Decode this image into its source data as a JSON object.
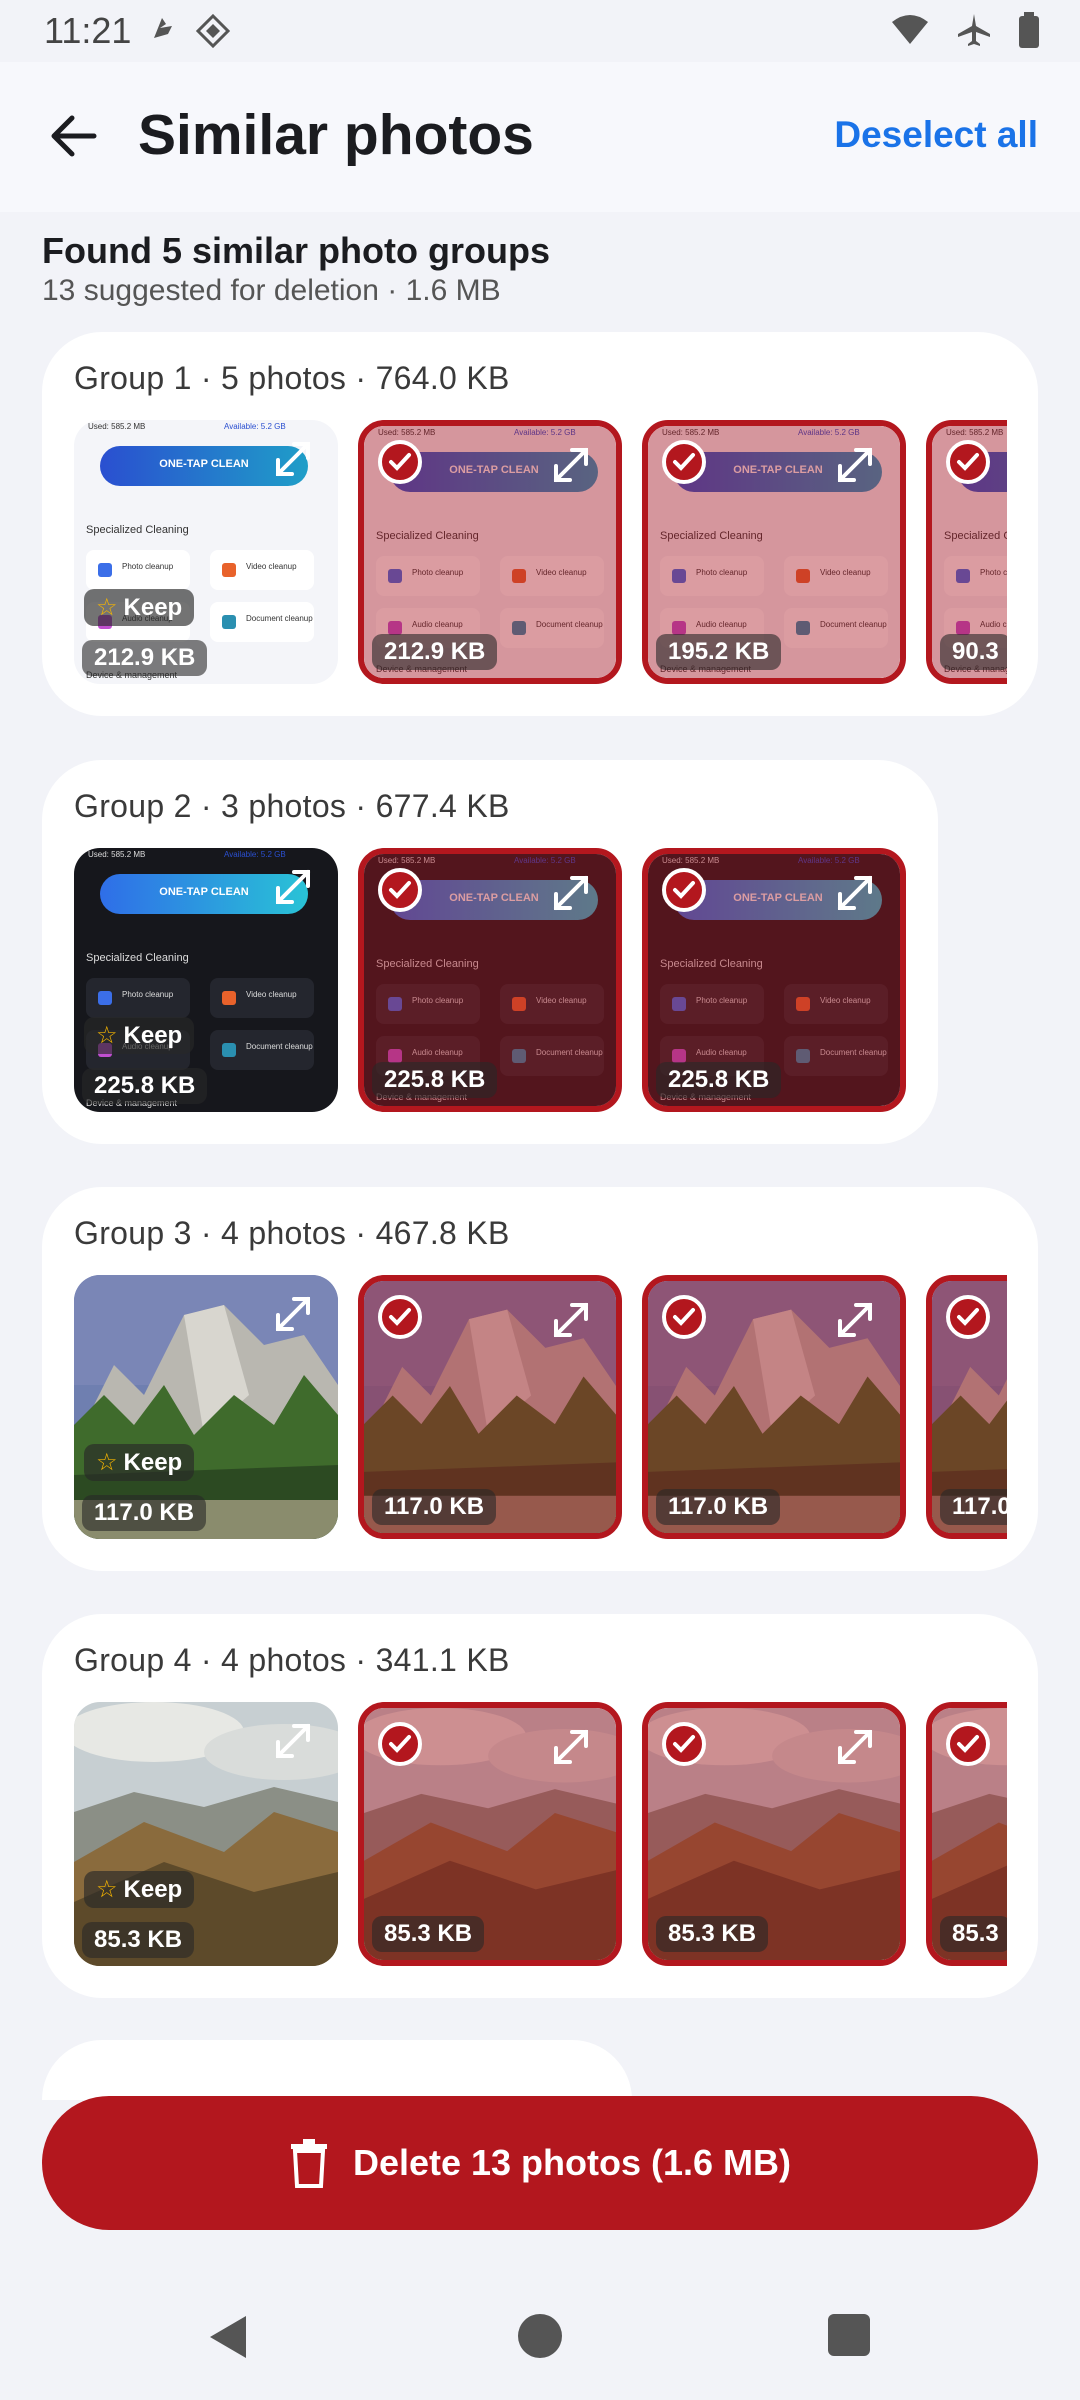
{
  "status": {
    "time": "11:21"
  },
  "header": {
    "title": "Similar photos",
    "deselect_label": "Deselect all"
  },
  "summary": {
    "title": "Found 5 similar photo groups",
    "subtitle": "13 suggested for deletion · 1.6 MB"
  },
  "groups": [
    {
      "title": "Group 1 · 5 photos · 764.0 KB",
      "thumbs": [
        {
          "size": "212.9 KB",
          "keep": true,
          "selected": false
        },
        {
          "size": "212.9 KB",
          "keep": false,
          "selected": true
        },
        {
          "size": "195.2 KB",
          "keep": false,
          "selected": true
        },
        {
          "size": "90.3",
          "keep": false,
          "selected": true
        }
      ]
    },
    {
      "title": "Group 2 · 3 photos · 677.4 KB",
      "thumbs": [
        {
          "size": "225.8 KB",
          "keep": true,
          "selected": false
        },
        {
          "size": "225.8 KB",
          "keep": false,
          "selected": true
        },
        {
          "size": "225.8 KB",
          "keep": false,
          "selected": true
        }
      ]
    },
    {
      "title": "Group 3 · 4 photos · 467.8 KB",
      "thumbs": [
        {
          "size": "117.0 KB",
          "keep": true,
          "selected": false
        },
        {
          "size": "117.0 KB",
          "keep": false,
          "selected": true
        },
        {
          "size": "117.0 KB",
          "keep": false,
          "selected": true
        },
        {
          "size": "117.0",
          "keep": false,
          "selected": true
        }
      ]
    },
    {
      "title": "Group 4 · 4 photos · 341.1 KB",
      "thumbs": [
        {
          "size": "85.3 KB",
          "keep": true,
          "selected": false
        },
        {
          "size": "85.3 KB",
          "keep": false,
          "selected": true
        },
        {
          "size": "85.3 KB",
          "keep": false,
          "selected": true
        },
        {
          "size": "85.3",
          "keep": false,
          "selected": true
        }
      ]
    }
  ],
  "keep_label": "Keep",
  "mock": {
    "top_used": "Used: 585.2 MB",
    "top_avail": "Available: 5.2 GB",
    "button": "ONE-TAP CLEAN",
    "heading": "Specialized Cleaning",
    "tiles": [
      "Photo cleanup",
      "Video cleanup",
      "Audio cleanup",
      "Document cleanup"
    ],
    "footer": "Device & management"
  },
  "delete_button": {
    "label": "Delete 13 photos (1.6 MB)"
  },
  "colors": {
    "accent": "#1a73e8",
    "danger": "#b3171e"
  }
}
